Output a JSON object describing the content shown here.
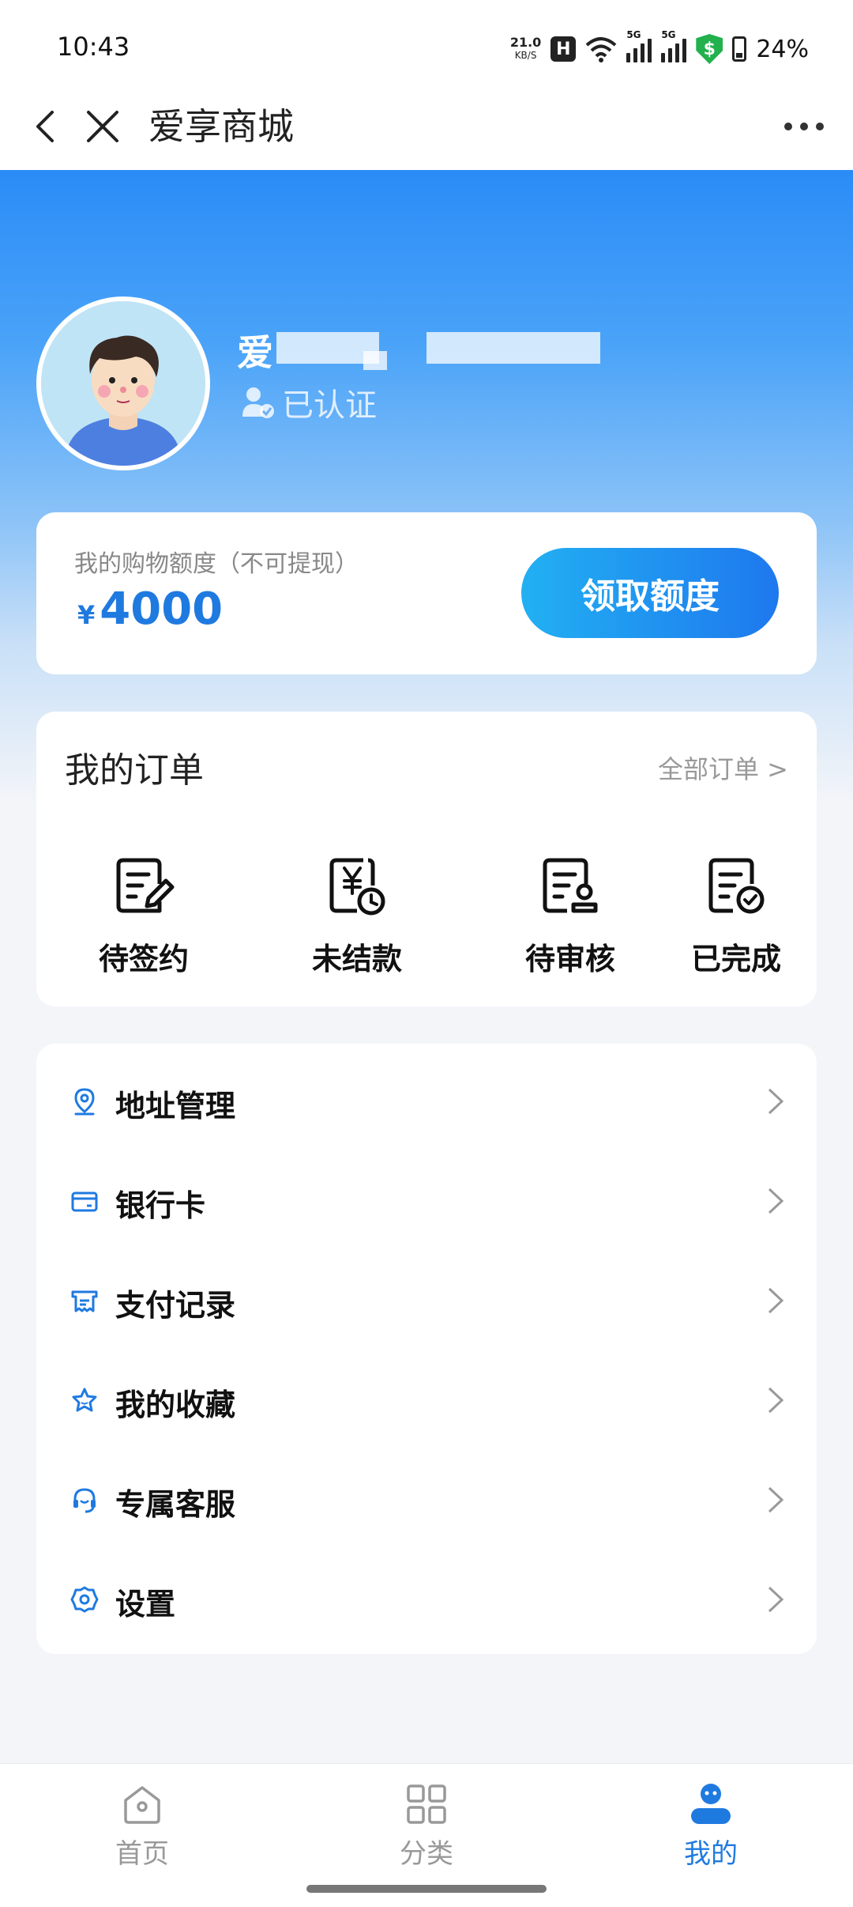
{
  "status_bar": {
    "time": "10:43",
    "net_speed_value": "21.0",
    "net_speed_unit": "KB/S",
    "h_badge": "H",
    "signal_tag": "5G",
    "shield_symbol": "$",
    "battery": "24%"
  },
  "nav": {
    "title": "爱享商城"
  },
  "profile": {
    "name_visible": "爱",
    "verified_label": "已认证"
  },
  "quota": {
    "label": "我的购物额度（不可提现）",
    "currency": "¥",
    "amount": "4000",
    "button_label": "领取额度"
  },
  "orders": {
    "title": "我的订单",
    "all_link": "全部订单 >",
    "items": [
      {
        "label": "待签约",
        "icon": "doc-edit-icon"
      },
      {
        "label": "未结款",
        "icon": "doc-yen-clock-icon"
      },
      {
        "label": "待审核",
        "icon": "doc-stamp-icon"
      },
      {
        "label": "已完成",
        "icon": "doc-check-icon"
      }
    ]
  },
  "menu": {
    "items": [
      {
        "label": "地址管理",
        "icon": "location-icon"
      },
      {
        "label": "银行卡",
        "icon": "card-icon"
      },
      {
        "label": "支付记录",
        "icon": "receipt-icon"
      },
      {
        "label": "我的收藏",
        "icon": "star-icon"
      },
      {
        "label": "专属客服",
        "icon": "headset-icon"
      },
      {
        "label": "设置",
        "icon": "gear-icon"
      }
    ]
  },
  "tabs": [
    {
      "label": "首页",
      "icon": "home-icon"
    },
    {
      "label": "分类",
      "icon": "grid-icon"
    },
    {
      "label": "我的",
      "icon": "profile-icon"
    }
  ],
  "colors": {
    "accent": "#1f7ae0",
    "header_top": "#2b8cf7",
    "button_start": "#22b0f2",
    "button_end": "#1e78ee"
  }
}
